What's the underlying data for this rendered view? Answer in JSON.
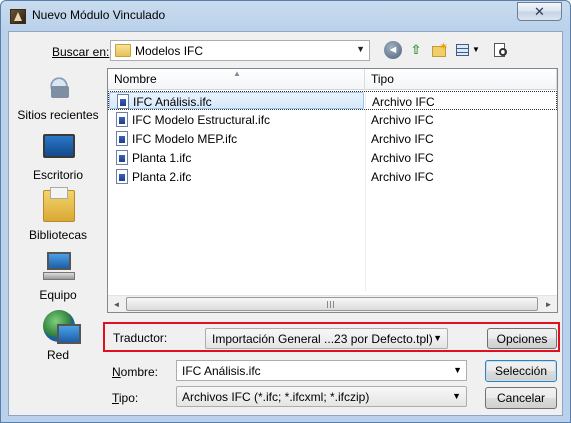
{
  "window": {
    "title": "Nuevo Módulo Vinculado",
    "close_label": "✕"
  },
  "toolbar": {
    "lookin_label": "Buscar en:",
    "lookin_value": "Modelos IFC",
    "buttons": [
      "back-icon",
      "up-folder-icon",
      "new-folder-icon",
      "views-menu-icon",
      "tools-icon"
    ]
  },
  "places": [
    {
      "label": "Sitios recientes",
      "icon": "recent-places-icon"
    },
    {
      "label": "Escritorio",
      "icon": "desktop-icon"
    },
    {
      "label": "Bibliotecas",
      "icon": "libraries-icon"
    },
    {
      "label": "Equipo",
      "icon": "computer-icon"
    },
    {
      "label": "Red",
      "icon": "network-icon"
    }
  ],
  "filelist": {
    "columns": [
      "Nombre",
      "Tipo"
    ],
    "rows": [
      {
        "name": "IFC Análisis.ifc",
        "type": "Archivo IFC",
        "selected": true
      },
      {
        "name": "IFC Modelo Estructural.ifc",
        "type": "Archivo IFC"
      },
      {
        "name": "IFC Modelo MEP.ifc",
        "type": "Archivo IFC"
      },
      {
        "name": "Planta 1.ifc",
        "type": "Archivo IFC"
      },
      {
        "name": "Planta 2.ifc",
        "type": "Archivo IFC"
      }
    ]
  },
  "translator": {
    "label": "Traductor:",
    "value": "Importación General ...23 por Defecto.tpl)",
    "options_label": "Opciones",
    "highlight_color": "#e01020"
  },
  "filename": {
    "label_prefix": "N",
    "label_rest": "ombre:",
    "value": "IFC Análisis.ifc"
  },
  "filetype": {
    "label_prefix": "T",
    "label_rest": "ipo:",
    "value": "Archivos IFC (*.ifc; *.ifcxml; *.ifczip)"
  },
  "buttons": {
    "select_label": "Selección",
    "cancel_label": "Cancelar"
  }
}
